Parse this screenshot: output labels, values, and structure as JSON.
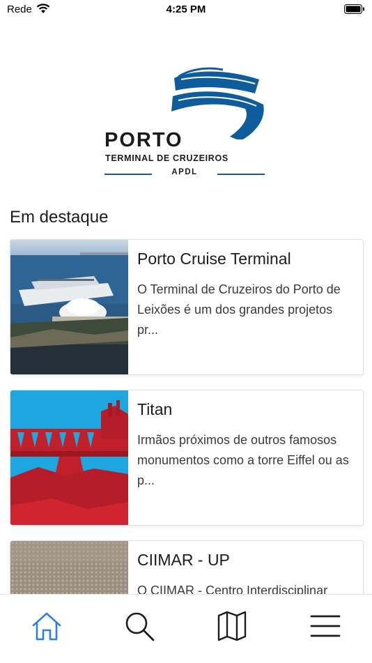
{
  "status_bar": {
    "carrier": "Rede",
    "time": "4:25 PM"
  },
  "logo": {
    "title": "PORTO",
    "subtitle": "TERMINAL DE CRUZEIROS",
    "org": "APDL",
    "brand_color": "#0f5c9c"
  },
  "featured": {
    "heading": "Em destaque",
    "cards": [
      {
        "title": "Porto Cruise Terminal",
        "description": "O Terminal de Cruzeiros do Porto de Leixões é um dos grandes projetos pr..."
      },
      {
        "title": "Titan",
        "description": "Irmãos próximos de outros famosos monumentos como a torre Eiffel ou as p..."
      },
      {
        "title": "CIIMAR - UP",
        "description": "O CIIMAR - Centro Interdisciplinar"
      }
    ]
  },
  "tab_bar": {
    "active_color": "#2f7fe0",
    "inactive_color": "#1c1c1e",
    "tabs": [
      {
        "icon": "home-icon",
        "active": true
      },
      {
        "icon": "search-icon",
        "active": false
      },
      {
        "icon": "map-icon",
        "active": false
      },
      {
        "icon": "menu-icon",
        "active": false
      }
    ]
  }
}
